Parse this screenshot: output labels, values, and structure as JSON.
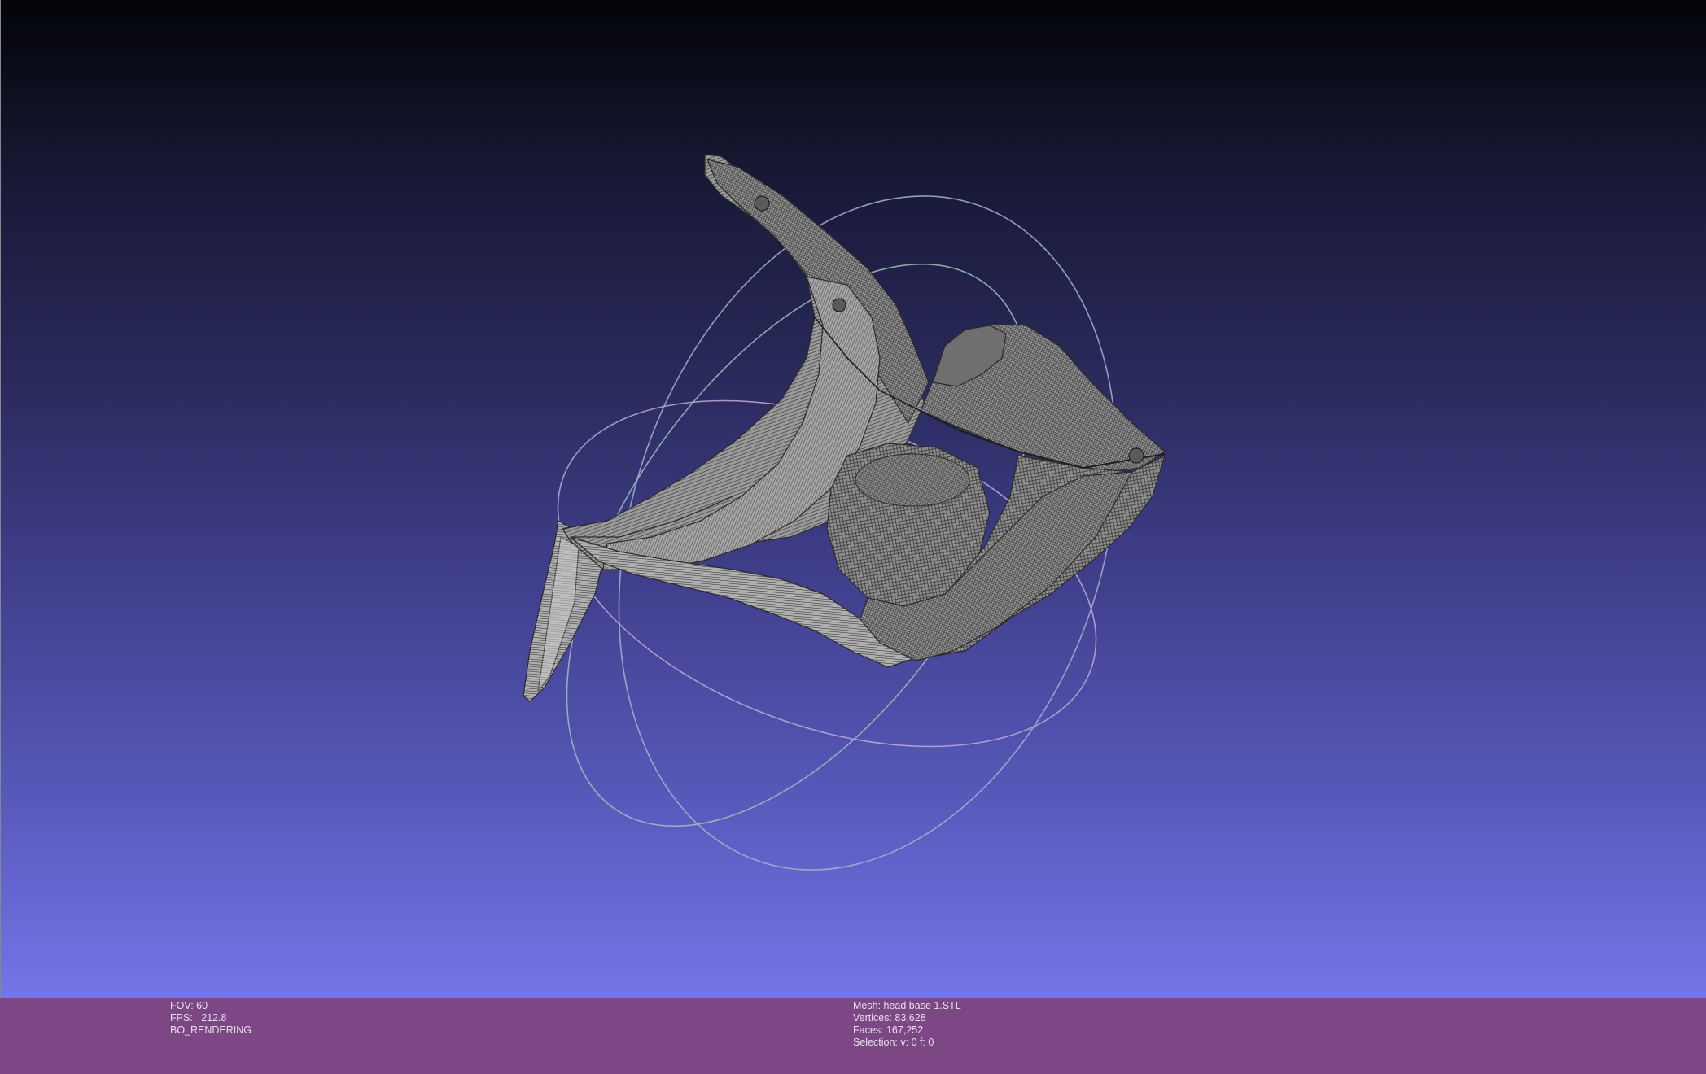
{
  "viewer": {
    "background_top": "#030408",
    "background_bottom": "#7475e8",
    "info_bar_color": "#7d4785",
    "trackball_colors": [
      "#9aa6c8",
      "#c9a0c6",
      "#8fb7b0"
    ],
    "mesh_color": "#8c8c8c"
  },
  "info_left": {
    "fov": "FOV: 60",
    "fps": "FPS:   212.8",
    "render_mode": "BO_RENDERING"
  },
  "info_right": {
    "mesh": "Mesh: head base 1.STL",
    "vertices": "Vertices: 83,628",
    "faces": "Faces: 167,252",
    "selection": "Selection: v: 0 f: 0"
  }
}
